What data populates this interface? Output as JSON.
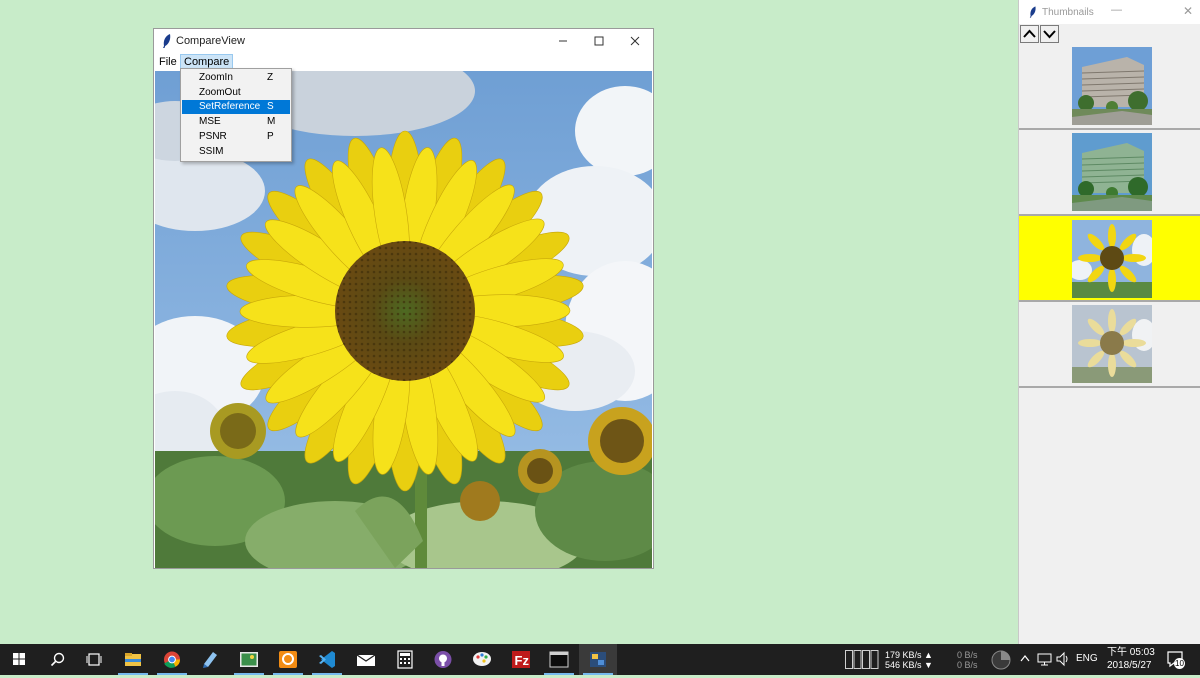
{
  "compare_window": {
    "title": "CompareView",
    "menu": {
      "file": "File",
      "compare": "Compare"
    },
    "icons": {
      "app": "feather-icon",
      "minimize": "minimize-icon",
      "maximize": "maximize-icon",
      "close": "close-icon"
    }
  },
  "compare_menu": {
    "items": [
      {
        "label": "ZoomIn",
        "accel": "Z"
      },
      {
        "label": "ZoomOut",
        "accel": ""
      },
      {
        "label": "SetReference",
        "accel": "S"
      },
      {
        "label": "MSE",
        "accel": "M"
      },
      {
        "label": "PSNR",
        "accel": "P"
      },
      {
        "label": "SSIM",
        "accel": ""
      }
    ],
    "highlighted": "SetReference"
  },
  "thumbnails_window": {
    "title": "Thumbnails",
    "minimize_glyph": "—",
    "close_glyph": "✕",
    "items": [
      {
        "image": "building-photo",
        "selected": false
      },
      {
        "image": "building-photo-green",
        "selected": false
      },
      {
        "image": "sunflower-photo",
        "selected": true
      },
      {
        "image": "sunflower-photo-faded",
        "selected": false
      }
    ]
  },
  "taskbar": {
    "apps": [
      "start-icon",
      "search-icon",
      "task-view-icon",
      "file-explorer-icon",
      "chrome-icon",
      "notepad-icon",
      "photo-editor-icon",
      "orange-app-icon",
      "vscode-icon",
      "mail-icon",
      "calculator-icon",
      "github-icon",
      "paint-icon",
      "filezilla-icon",
      "terminal-icon",
      "python-app-icon"
    ],
    "network": {
      "upload": "179 KB/s ▲",
      "download": "546 KB/s ▼"
    },
    "disk": {
      "read": "0 B/s",
      "write": "0 B/s"
    },
    "language": "ENG",
    "time": "下午 05:03",
    "date": "2018/5/27",
    "notification_count": "10"
  },
  "colors": {
    "desktop": "#c8ecc9",
    "selection": "#0078d7",
    "thumb_selected": "#ffff00",
    "taskbar": "#1f1f1f"
  }
}
